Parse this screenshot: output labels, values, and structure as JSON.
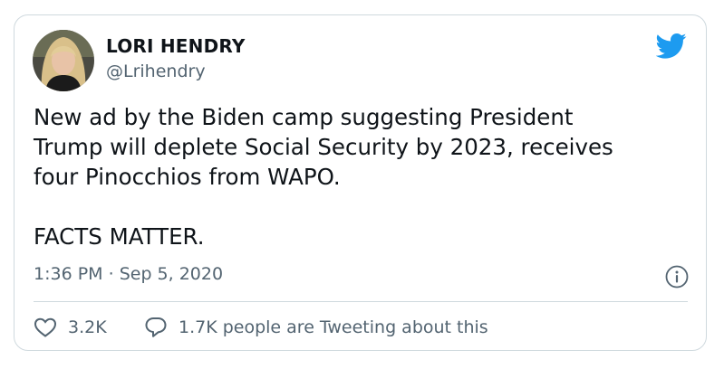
{
  "tweet": {
    "author_name": "LORI HENDRY",
    "author_handle": "@Lrihendry",
    "text_lines": [
      "New ad by the Biden camp suggesting President",
      "Trump will deplete Social Security by 2023, receives",
      "four Pinocchios from WAPO.",
      "",
      "FACTS MATTER."
    ],
    "time": "1:36 PM",
    "separator": "·",
    "date": "Sep 5, 2020",
    "likes": "3.2K",
    "tweeting_text": "1.7K people are Tweeting about this"
  },
  "icons": {
    "brand": "twitter-bird-icon",
    "info": "info-icon",
    "like": "heart-icon",
    "reply": "speech-bubble-icon"
  },
  "colors": {
    "brand": "#1d9bf0",
    "text": "#0f1419",
    "secondary": "#536471",
    "border": "#cfd9de"
  }
}
